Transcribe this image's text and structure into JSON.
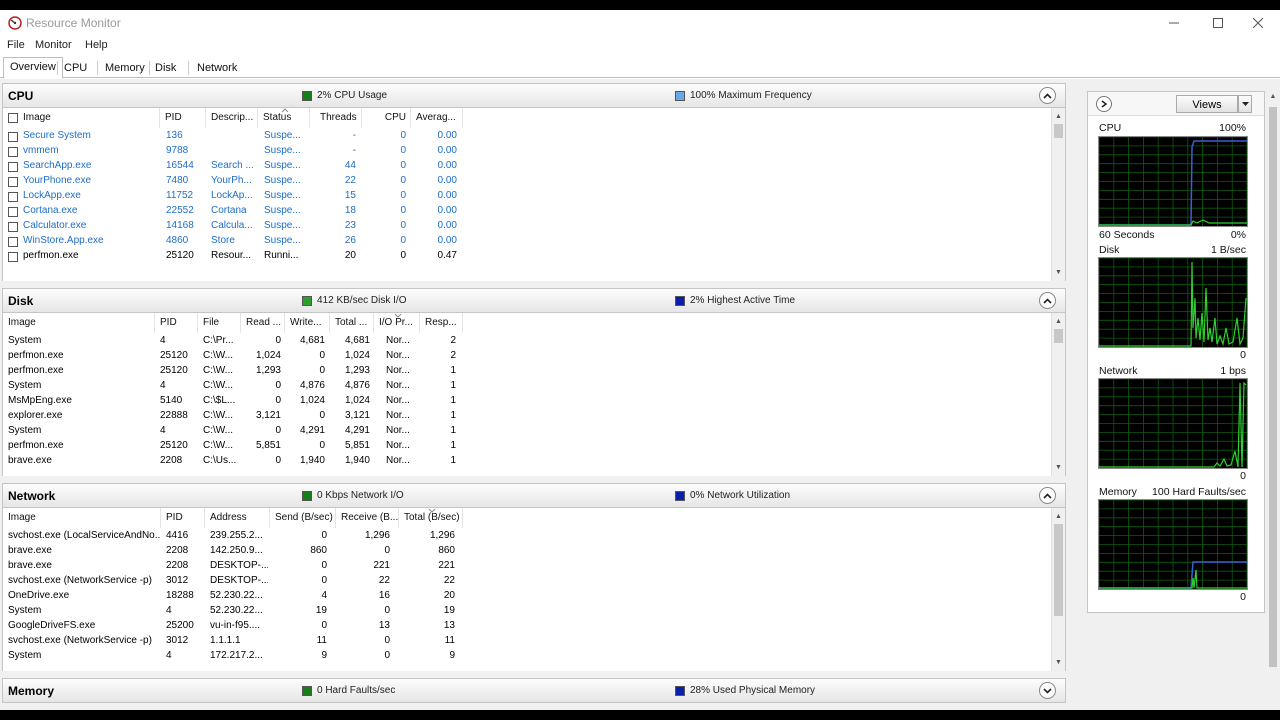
{
  "window": {
    "title": "Resource Monitor"
  },
  "menu": [
    "File",
    "Monitor",
    "Help"
  ],
  "tabs": [
    "Overview",
    "CPU",
    "Memory",
    "Disk",
    "Network"
  ],
  "cpu": {
    "title": "CPU",
    "legend1": "2% CPU Usage",
    "legend1_color": "#1a7d1a",
    "legend2": "100% Maximum Frequency",
    "legend2_color": "#6aa8e8",
    "columns": [
      "Image",
      "PID",
      "Descrip...",
      "Status",
      "Threads",
      "CPU",
      "Averag..."
    ],
    "rows": [
      [
        "Secure System",
        "136",
        "",
        "Suspe...",
        "-",
        "0",
        "0.00"
      ],
      [
        "vmmem",
        "9788",
        "",
        "Suspe...",
        "-",
        "0",
        "0.00"
      ],
      [
        "SearchApp.exe",
        "16544",
        "Search ...",
        "Suspe...",
        "44",
        "0",
        "0.00"
      ],
      [
        "YourPhone.exe",
        "7480",
        "YourPh...",
        "Suspe...",
        "22",
        "0",
        "0.00"
      ],
      [
        "LockApp.exe",
        "11752",
        "LockAp...",
        "Suspe...",
        "15",
        "0",
        "0.00"
      ],
      [
        "Cortana.exe",
        "22552",
        "Cortana",
        "Suspe...",
        "18",
        "0",
        "0.00"
      ],
      [
        "Calculator.exe",
        "14168",
        "Calcula...",
        "Suspe...",
        "23",
        "0",
        "0.00"
      ],
      [
        "WinStore.App.exe",
        "4860",
        "Store",
        "Suspe...",
        "26",
        "0",
        "0.00"
      ],
      [
        "perfmon.exe",
        "25120",
        "Resour...",
        "Runni...",
        "20",
        "0",
        "0.47"
      ]
    ]
  },
  "disk": {
    "title": "Disk",
    "legend1": "412 KB/sec Disk I/O",
    "legend1_color": "#2ca02c",
    "legend2": "2% Highest Active Time",
    "legend2_color": "#0a1ea8",
    "columns": [
      "Image",
      "PID",
      "File",
      "Read ...",
      "Write...",
      "Total ...",
      "I/O Pr...",
      "Resp..."
    ],
    "rows": [
      [
        "System",
        "4",
        "C:\\Pr...",
        "0",
        "4,681",
        "4,681",
        "Nor...",
        "2"
      ],
      [
        "perfmon.exe",
        "25120",
        "C:\\W...",
        "1,024",
        "0",
        "1,024",
        "Nor...",
        "2"
      ],
      [
        "perfmon.exe",
        "25120",
        "C:\\W...",
        "1,293",
        "0",
        "1,293",
        "Nor...",
        "1"
      ],
      [
        "System",
        "4",
        "C:\\W...",
        "0",
        "4,876",
        "4,876",
        "Nor...",
        "1"
      ],
      [
        "MsMpEng.exe",
        "5140",
        "C:\\$L...",
        "0",
        "1,024",
        "1,024",
        "Nor...",
        "1"
      ],
      [
        "explorer.exe",
        "22888",
        "C:\\W...",
        "3,121",
        "0",
        "3,121",
        "Nor...",
        "1"
      ],
      [
        "System",
        "4",
        "C:\\W...",
        "0",
        "4,291",
        "4,291",
        "Nor...",
        "1"
      ],
      [
        "perfmon.exe",
        "25120",
        "C:\\W...",
        "5,851",
        "0",
        "5,851",
        "Nor...",
        "1"
      ],
      [
        "brave.exe",
        "2208",
        "C:\\Us...",
        "0",
        "1,940",
        "1,940",
        "Nor...",
        "1"
      ]
    ]
  },
  "network": {
    "title": "Network",
    "legend1": "0 Kbps Network I/O",
    "legend1_color": "#1a7d1a",
    "legend2": "0% Network Utilization",
    "legend2_color": "#0a1ea8",
    "columns": [
      "Image",
      "PID",
      "Address",
      "Send (B/sec)",
      "Receive (B...",
      "Total (B/sec)"
    ],
    "rows": [
      [
        "svchost.exe (LocalServiceAndNo...",
        "4416",
        "239.255.2...",
        "0",
        "1,296",
        "1,296"
      ],
      [
        "brave.exe",
        "2208",
        "142.250.9...",
        "860",
        "0",
        "860"
      ],
      [
        "brave.exe",
        "2208",
        "DESKTOP-...",
        "0",
        "221",
        "221"
      ],
      [
        "svchost.exe (NetworkService -p)",
        "3012",
        "DESKTOP-...",
        "0",
        "22",
        "22"
      ],
      [
        "OneDrive.exe",
        "18288",
        "52.230.22...",
        "4",
        "16",
        "20"
      ],
      [
        "System",
        "4",
        "52.230.22...",
        "19",
        "0",
        "19"
      ],
      [
        "GoogleDriveFS.exe",
        "25200",
        "vu-in-f95....",
        "0",
        "13",
        "13"
      ],
      [
        "svchost.exe (NetworkService -p)",
        "3012",
        "1.1.1.1",
        "11",
        "0",
        "11"
      ],
      [
        "System",
        "4",
        "172.217.2...",
        "9",
        "0",
        "9"
      ]
    ]
  },
  "memory": {
    "title": "Memory",
    "legend1": "0 Hard Faults/sec",
    "legend1_color": "#1a7d1a",
    "legend2": "28% Used Physical Memory",
    "legend2_color": "#0a1ea8"
  },
  "right_pane": {
    "views_label": "Views",
    "graphs": [
      {
        "name": "CPU",
        "max": "100%",
        "min": "0%",
        "footer": "60 Seconds"
      },
      {
        "name": "Disk",
        "max": "1 B/sec",
        "min": "0"
      },
      {
        "name": "Network",
        "max": "1 bps",
        "min": "0"
      },
      {
        "name": "Memory",
        "max": "100 Hard Faults/sec",
        "min": "0"
      }
    ]
  }
}
